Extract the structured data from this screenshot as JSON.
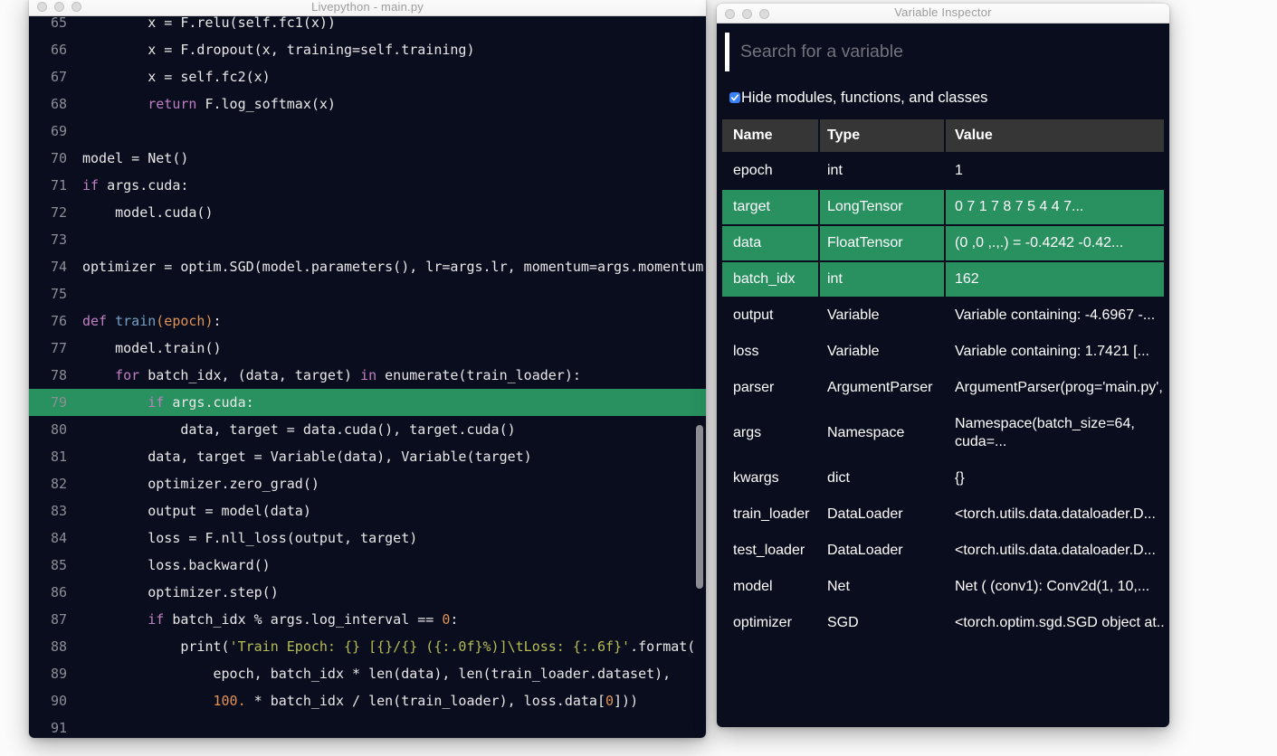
{
  "editor_window": {
    "title": "Livepython - main.py",
    "traffic_lights": [
      "close",
      "minimize",
      "zoom"
    ],
    "highlight_line": 79,
    "colors": {
      "edbg": "#0a0d1e",
      "green": "#28915f",
      "lnum": "#8d8d96",
      "plain": "#e8e8e8",
      "kw": "#c07fc2",
      "fn": "#72a0c5",
      "orange": "#df9356",
      "str": "#b6bd52"
    },
    "lines": [
      {
        "n": 65,
        "tokens": [
          [
            "p",
            "        x = F.relu(self.fc1(x))"
          ]
        ]
      },
      {
        "n": 66,
        "tokens": [
          [
            "p",
            "        x = F.dropout(x, training=self.training)"
          ]
        ]
      },
      {
        "n": 67,
        "tokens": [
          [
            "p",
            "        x = self.fc2(x)"
          ]
        ]
      },
      {
        "n": 68,
        "tokens": [
          [
            "p",
            "        "
          ],
          [
            "k",
            "return"
          ],
          [
            "p",
            " F.log_softmax(x)"
          ]
        ]
      },
      {
        "n": 69,
        "tokens": []
      },
      {
        "n": 70,
        "tokens": [
          [
            "p",
            "model = Net()"
          ]
        ]
      },
      {
        "n": 71,
        "tokens": [
          [
            "k",
            "if"
          ],
          [
            "p",
            " args.cuda:"
          ]
        ]
      },
      {
        "n": 72,
        "tokens": [
          [
            "p",
            "    model.cuda()"
          ]
        ]
      },
      {
        "n": 73,
        "tokens": []
      },
      {
        "n": 74,
        "tokens": [
          [
            "p",
            "optimizer = optim.SGD(model.parameters(), lr=args.lr, momentum=args.momentum)"
          ]
        ]
      },
      {
        "n": 75,
        "tokens": []
      },
      {
        "n": 76,
        "tokens": [
          [
            "k",
            "def"
          ],
          [
            "p",
            " "
          ],
          [
            "f",
            "train"
          ],
          [
            "o",
            "(epoch)"
          ],
          [
            "p",
            ":"
          ]
        ]
      },
      {
        "n": 77,
        "tokens": [
          [
            "p",
            "    model.train()"
          ]
        ]
      },
      {
        "n": 78,
        "tokens": [
          [
            "p",
            "    "
          ],
          [
            "k",
            "for"
          ],
          [
            "p",
            " batch_idx, (data, target) "
          ],
          [
            "k",
            "in"
          ],
          [
            "p",
            " enumerate(train_loader):"
          ]
        ]
      },
      {
        "n": 79,
        "tokens": [
          [
            "p",
            "        "
          ],
          [
            "k",
            "if"
          ],
          [
            "p",
            " args.cuda:"
          ]
        ]
      },
      {
        "n": 80,
        "tokens": [
          [
            "p",
            "            data, target = data.cuda(), target.cuda()"
          ]
        ]
      },
      {
        "n": 81,
        "tokens": [
          [
            "p",
            "        data, target = Variable(data), Variable(target)"
          ]
        ]
      },
      {
        "n": 82,
        "tokens": [
          [
            "p",
            "        optimizer.zero_grad()"
          ]
        ]
      },
      {
        "n": 83,
        "tokens": [
          [
            "p",
            "        output = model(data)"
          ]
        ]
      },
      {
        "n": 84,
        "tokens": [
          [
            "p",
            "        loss = F.nll_loss(output, target)"
          ]
        ]
      },
      {
        "n": 85,
        "tokens": [
          [
            "p",
            "        loss.backward()"
          ]
        ]
      },
      {
        "n": 86,
        "tokens": [
          [
            "p",
            "        optimizer.step()"
          ]
        ]
      },
      {
        "n": 87,
        "tokens": [
          [
            "p",
            "        "
          ],
          [
            "k",
            "if"
          ],
          [
            "p",
            " batch_idx % args.log_interval == "
          ],
          [
            "o",
            "0"
          ],
          [
            "p",
            ":"
          ]
        ]
      },
      {
        "n": 88,
        "tokens": [
          [
            "p",
            "            print("
          ],
          [
            "s",
            "'Train Epoch: {} [{}/{} ({:.0f}%)]\\tLoss: {:.6f}'"
          ],
          [
            "p",
            ".format("
          ]
        ]
      },
      {
        "n": 89,
        "tokens": [
          [
            "p",
            "                epoch, batch_idx * len(data), len(train_loader.dataset),"
          ]
        ]
      },
      {
        "n": 90,
        "tokens": [
          [
            "p",
            "                "
          ],
          [
            "o",
            "100."
          ],
          [
            "p",
            " * batch_idx / len(train_loader), loss.data["
          ],
          [
            "o",
            "0"
          ],
          [
            "p",
            "]))"
          ]
        ]
      },
      {
        "n": 91,
        "tokens": []
      }
    ]
  },
  "inspector_window": {
    "title": "Variable Inspector",
    "traffic_lights": [
      "close",
      "minimize",
      "zoom"
    ],
    "search": {
      "placeholder": "Search for a variable",
      "value": ""
    },
    "filter_checkbox": {
      "checked": true,
      "label": "Hide modules, functions, and classes"
    },
    "table": {
      "columns": [
        "Name",
        "Type",
        "Value"
      ],
      "rows": [
        {
          "name": "epoch",
          "type": "int",
          "value": "1",
          "highlighted": false
        },
        {
          "name": "target",
          "type": "LongTensor",
          "value": "0 7 1 7 8 7 5 4 4 7...",
          "highlighted": true
        },
        {
          "name": "data",
          "type": "FloatTensor",
          "value": "(0 ,0 ,.,.) = -0.4242 -0.42...",
          "highlighted": true
        },
        {
          "name": "batch_idx",
          "type": "int",
          "value": "162",
          "highlighted": true
        },
        {
          "name": "output",
          "type": "Variable",
          "value": "Variable containing: -4.6967 -...",
          "highlighted": false
        },
        {
          "name": "loss",
          "type": "Variable",
          "value": "Variable containing: 1.7421 [...",
          "highlighted": false
        },
        {
          "name": "parser",
          "type": "ArgumentParser",
          "value": "ArgumentParser(prog='main.py',...",
          "highlighted": false
        },
        {
          "name": "args",
          "type": "Namespace",
          "value": "Namespace(batch_size=64,\ncuda=...",
          "highlighted": false
        },
        {
          "name": "kwargs",
          "type": "dict",
          "value": "{}",
          "highlighted": false
        },
        {
          "name": "train_loader",
          "type": "DataLoader",
          "value": "<torch.utils.data.dataloader.D...",
          "highlighted": false
        },
        {
          "name": "test_loader",
          "type": "DataLoader",
          "value": "<torch.utils.data.dataloader.D...",
          "highlighted": false
        },
        {
          "name": "model",
          "type": "Net",
          "value": "Net ( (conv1): Conv2d(1, 10,...",
          "highlighted": false
        },
        {
          "name": "optimizer",
          "type": "SGD",
          "value": "<torch.optim.sgd.SGD object at...",
          "highlighted": false
        }
      ]
    }
  }
}
